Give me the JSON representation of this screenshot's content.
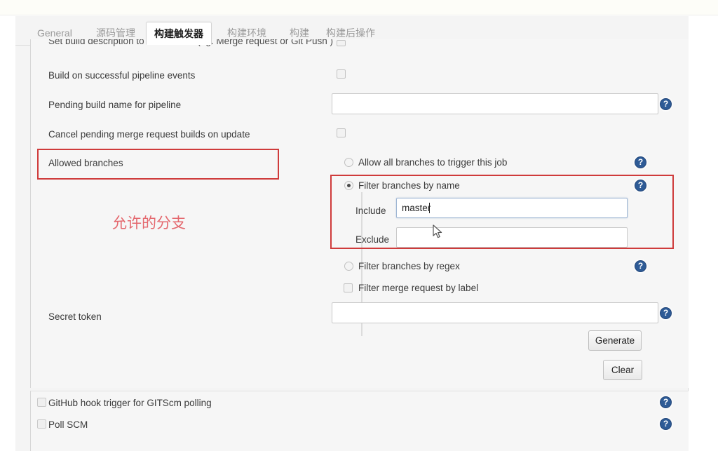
{
  "window": {
    "tabs": [
      {
        "label": "General",
        "active": false
      },
      {
        "label": "源码管理",
        "active": false
      },
      {
        "label": "构建触发器",
        "active": true
      },
      {
        "label": "构建环境",
        "active": false
      },
      {
        "label": "构建",
        "active": false
      },
      {
        "label": "构建后操作",
        "active": false
      }
    ]
  },
  "form": {
    "clipped_row_label": "Set build description to build cause (eg. Merge request or Git Push )",
    "build_on_successful_pipeline_events": "Build on successful pipeline events",
    "pending_build_name_for_pipeline": "Pending build name for pipeline",
    "pending_build_name_value": "",
    "cancel_pending_merge_request_builds": "Cancel pending merge request builds on update",
    "allowed_branches": "Allowed branches",
    "allow_all_branches": "Allow all branches to trigger this job",
    "filter_branches_by_name": "Filter branches by name",
    "include_label": "Include",
    "include_value": "master",
    "exclude_label": "Exclude",
    "exclude_value": "",
    "filter_branches_by_regex": "Filter branches by regex",
    "filter_merge_request_by_label": "Filter merge request by label",
    "secret_token_label": "Secret token",
    "secret_token_value": "",
    "generate_button": "Generate",
    "clear_button": "Clear"
  },
  "bottom": {
    "github_hook_trigger": "GitHub hook trigger for GITScm polling",
    "poll_scm": "Poll SCM"
  },
  "annotations": {
    "allowed_branches_note": "允许的分支"
  },
  "icons": {
    "help": "?"
  },
  "colors": {
    "annotation_red": "#cf3b3b",
    "annotation_text_red": "#e4676d",
    "help_blue": "#2e5b96",
    "page_bg": "#f4f4f4",
    "panel_bg": "#f6f6f6"
  }
}
